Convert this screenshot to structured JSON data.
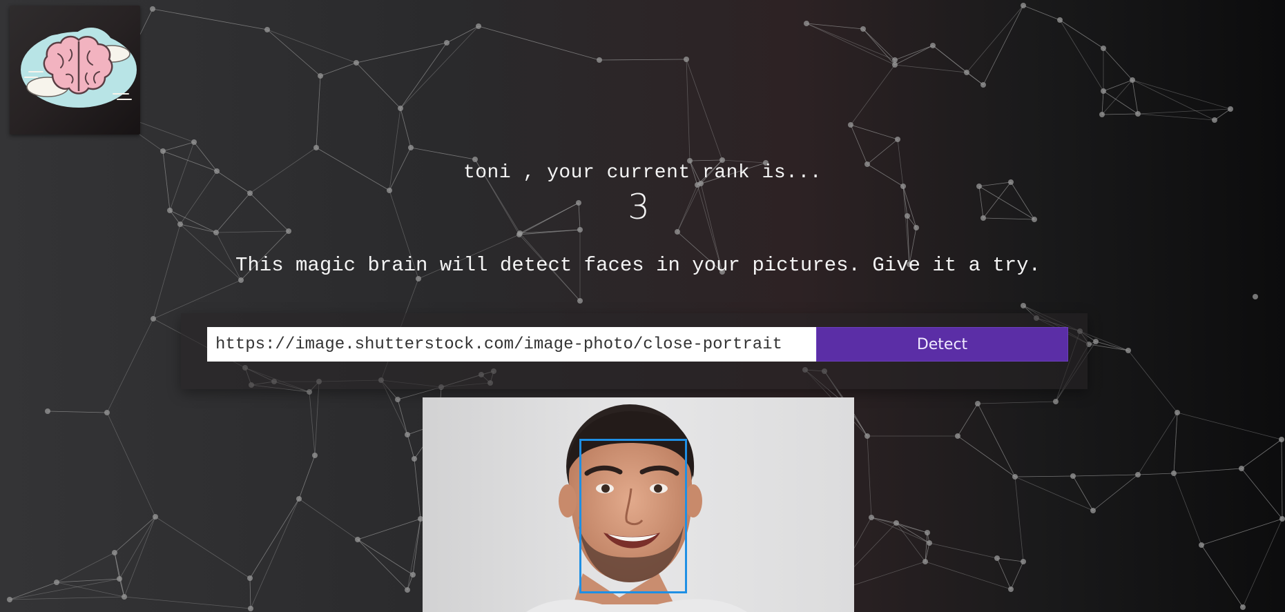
{
  "logo": {
    "icon": "brain-icon"
  },
  "rank": {
    "user_name": "toni",
    "text": " , your current rank is...",
    "number": "3"
  },
  "info": {
    "text": "This magic brain will detect faces in your pictures. Give it a try."
  },
  "form": {
    "input_value": "https://image.shutterstock.com/image-photo/close-portrait",
    "button_label": "Detect"
  },
  "result": {
    "face_box_color": "#1e8fe4",
    "detected_faces": 1
  },
  "colors": {
    "accent": "#5b2ea6",
    "particle": "#9a9a9a"
  }
}
